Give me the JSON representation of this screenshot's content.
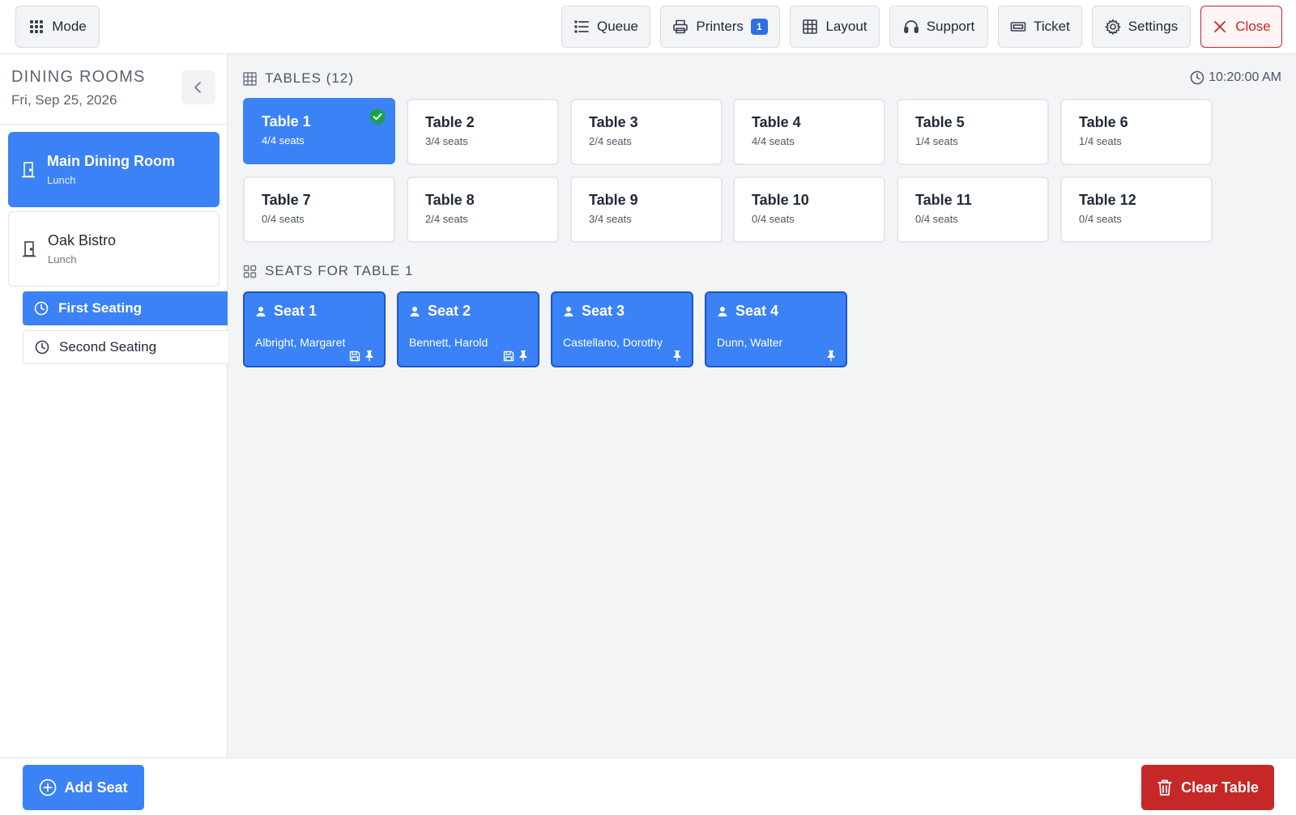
{
  "colors": {
    "primary": "#3b82f6",
    "danger": "#c62828",
    "success": "#16a34a"
  },
  "toolbar": {
    "mode": {
      "label": "Mode",
      "icon": "grid-icon"
    },
    "queue": {
      "label": "Queue",
      "icon": "list-icon"
    },
    "printers": {
      "label": "Printers",
      "icon": "printer-icon",
      "badge": "1"
    },
    "layout": {
      "label": "Layout",
      "icon": "table-grid-icon"
    },
    "support": {
      "label": "Support",
      "icon": "headset-icon"
    },
    "ticket": {
      "label": "Ticket",
      "icon": "ticket-icon"
    },
    "settings": {
      "label": "Settings",
      "icon": "gear-icon"
    },
    "close": {
      "label": "Close",
      "icon": "close-icon"
    }
  },
  "sidebar": {
    "title": "DINING ROOMS",
    "date": "Fri, Sep 25, 2026",
    "rooms": [
      {
        "name": "Main Dining Room",
        "sub": "Lunch",
        "icon": "door-icon"
      },
      {
        "name": "Oak Bistro",
        "sub": "Lunch",
        "icon": "door-icon"
      }
    ],
    "seatings": [
      {
        "label": "First Seating",
        "icon": "clock-icon"
      },
      {
        "label": "Second Seating",
        "icon": "clock-icon"
      }
    ]
  },
  "main": {
    "tables_header": "TABLES (12)",
    "time": "10:20:00 AM",
    "tables": [
      {
        "name": "Table 1",
        "seats": "4/4 seats"
      },
      {
        "name": "Table 2",
        "seats": "3/4 seats"
      },
      {
        "name": "Table 3",
        "seats": "2/4 seats"
      },
      {
        "name": "Table 4",
        "seats": "4/4 seats"
      },
      {
        "name": "Table 5",
        "seats": "1/4 seats"
      },
      {
        "name": "Table 6",
        "seats": "1/4 seats"
      },
      {
        "name": "Table 7",
        "seats": "0/4 seats"
      },
      {
        "name": "Table 8",
        "seats": "2/4 seats"
      },
      {
        "name": "Table 9",
        "seats": "3/4 seats"
      },
      {
        "name": "Table 10",
        "seats": "0/4 seats"
      },
      {
        "name": "Table 11",
        "seats": "0/4 seats"
      },
      {
        "name": "Table 12",
        "seats": "0/4 seats"
      }
    ],
    "seats_header": "SEATS FOR TABLE 1",
    "seats": [
      {
        "label": "Seat 1",
        "guest": "Albright, Margaret",
        "icons": [
          "save-icon",
          "pin-icon"
        ]
      },
      {
        "label": "Seat 2",
        "guest": "Bennett, Harold",
        "icons": [
          "save-icon",
          "pin-icon"
        ]
      },
      {
        "label": "Seat 3",
        "guest": "Castellano, Dorothy",
        "icons": [
          "pin-icon"
        ]
      },
      {
        "label": "Seat 4",
        "guest": "Dunn, Walter",
        "icons": [
          "pin-icon"
        ]
      }
    ]
  },
  "footer": {
    "add_seat": "Add Seat",
    "clear_table": "Clear Table"
  }
}
